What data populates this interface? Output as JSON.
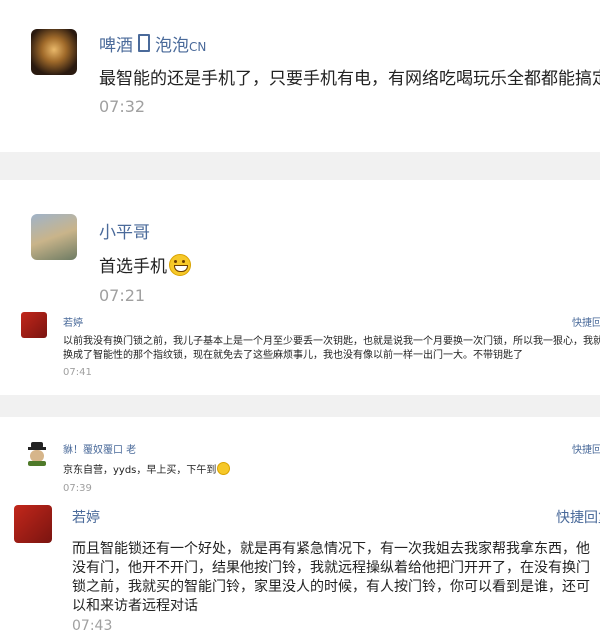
{
  "comments": [
    {
      "author": "啤酒",
      "author_suffix": "泡泡",
      "author_tag": "CN",
      "text": "最智能的还是手机了，只要手机有电，有网络吃喝玩乐全都都能搞定！",
      "time": "07:32"
    },
    {
      "author": "小平哥",
      "text": "首选手机",
      "time": "07:21"
    },
    {
      "author": "若婷",
      "reply_label": "快捷回",
      "text_lines": [
        "以前我没有换门锁之前，我儿子基本上是一个月至少要丢一次钥匙，也就是说我一个月要换一次门锁，所以我一狠心，我就",
        "换成了智能性的那个指纹锁，现在就免去了这些麻烦事儿，我也没有像以前一样一出门一大。不带钥匙了"
      ],
      "time": "07:41"
    },
    {
      "author": "貅！覆奴覆口 老",
      "reply_label": "快捷回",
      "text": "京东自营，yyds，早上买，下午到",
      "time": "07:39"
    },
    {
      "author": "若婷",
      "reply_label": "快捷回复",
      "text_lines": [
        "而且智能锁还有一个好处，就是再有紧急情况下，有一次我姐去我家帮我拿东西，他",
        "没有门，他开不开门，结果他按门铃，我就远程操纵着给他把门开开了，在没有换门",
        "锁之前，我就买的智能门铃，家里没人的时候，有人按门铃，你可以看到是谁，还可",
        "以和来访者远程对话"
      ],
      "time": "07:43"
    }
  ]
}
